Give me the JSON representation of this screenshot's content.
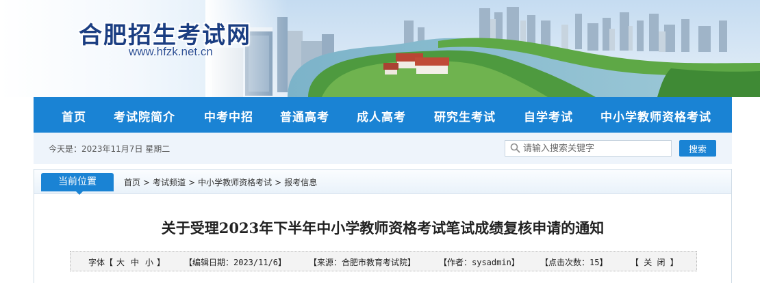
{
  "header": {
    "site_title": "合肥招生考试网",
    "site_url": "www.hfzk.net.cn"
  },
  "nav": {
    "items": [
      {
        "label": "首页"
      },
      {
        "label": "考试院简介"
      },
      {
        "label": "中考中招"
      },
      {
        "label": "普通高考"
      },
      {
        "label": "成人高考"
      },
      {
        "label": "研究生考试"
      },
      {
        "label": "自学考试"
      },
      {
        "label": "中小学教师资格考试"
      }
    ]
  },
  "infobar": {
    "today": "今天是：2023年11月7日 星期二",
    "search_placeholder": "请输入搜索关键字",
    "search_button": "搜索"
  },
  "breadcrumb": {
    "location_label": "当前位置",
    "items": [
      "首页",
      "考试频道",
      "中小学教师资格考试",
      "报考信息"
    ],
    "separator": ">"
  },
  "article": {
    "title": "关于受理2023年下半年中小学教师资格考试笔试成绩复核申请的通知",
    "meta": {
      "font_label": "字体【",
      "font_large": "大",
      "font_medium": "中",
      "font_small": "小",
      "font_close": "】",
      "date": "【编辑日期：2023/11/6】",
      "source": "【来源：合肥市教育考试院】",
      "author": "【作者：sysadmin】",
      "clicks": "【点击次数：15】",
      "close": "【 关 闭 】"
    }
  },
  "colors": {
    "nav_bg": "#1a83d4",
    "title_blue": "#1b3e82"
  }
}
